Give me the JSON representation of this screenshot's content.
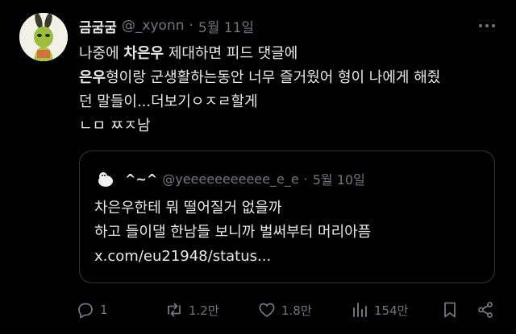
{
  "tweet": {
    "author": {
      "name": "금굼굼",
      "handle": "@_xyonn",
      "separator": "·",
      "date": "5월 11일"
    },
    "body": {
      "line1_pre": "나중에 ",
      "line1_bold": "차은우",
      "line1_post": " 제대하면 피드 댓글에",
      "line2_bold": "은우",
      "line2_post": "형이랑 군생활하는동안 너무 즐거웠어 형이 나에게 해줬",
      "line3": "던 말들이...더보기ㅇㅈㄹ할게",
      "line4": "ㄴㅁ ㅉㅈ남"
    },
    "quote": {
      "name": "^~^",
      "handle": "@yeeeeeeeeeee_e_e",
      "separator": "·",
      "date": "5월 10일",
      "line1": "차은우한테 뭐 떨어질거 없을까",
      "line2": "하고 들이댈 한남들 보니까 벌써부터 머리아픔",
      "line3": "x.com/eu21948/status..."
    },
    "actions": {
      "reply_count": "1",
      "retweet_count": "1.2만",
      "like_count": "1.8만",
      "view_count": "154만"
    }
  },
  "icons": [
    "more-icon",
    "reply-icon",
    "retweet-icon",
    "like-icon",
    "views-icon",
    "bookmark-icon",
    "share-icon"
  ],
  "colors": {
    "background": "#000000",
    "text": "#e7e9ea",
    "muted": "#71767b",
    "border": "#333639"
  }
}
